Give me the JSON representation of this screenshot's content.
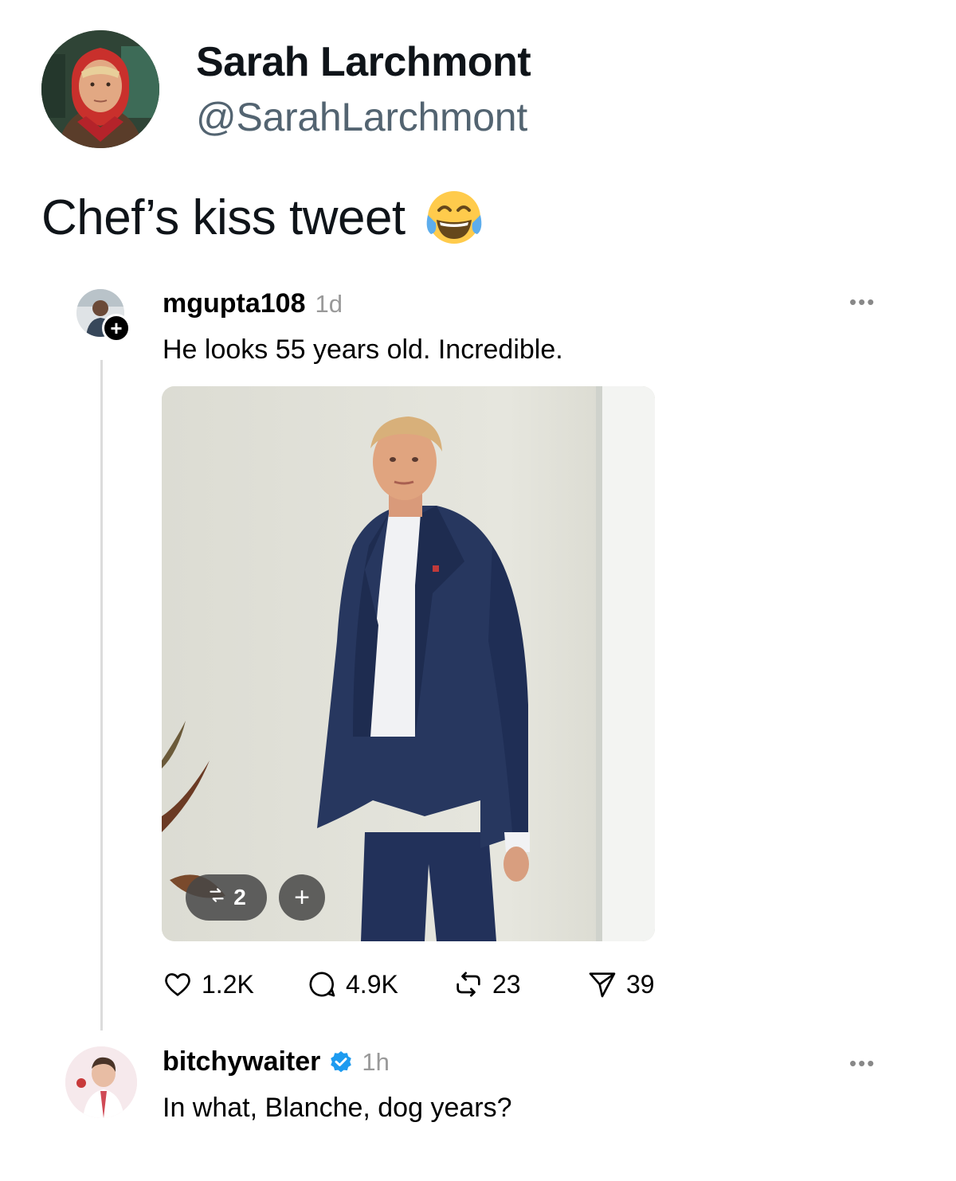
{
  "author": {
    "name": "Sarah Larchmont",
    "handle": "@SarahLarchmont"
  },
  "tweet": {
    "text": "Chef’s kiss tweet",
    "emoji": "face-with-tears-of-joy"
  },
  "quoted_post": {
    "username": "mgupta108",
    "time": "1d",
    "text": "He looks 55 years old. Incredible.",
    "image_reposts": "2",
    "stats": {
      "likes": "1.2K",
      "replies": "4.9K",
      "reposts": "23",
      "shares": "39"
    }
  },
  "reply_post": {
    "username": "bitchywaiter",
    "verified": true,
    "time": "1h",
    "text": "In what, Blanche, dog years?"
  },
  "colors": {
    "handle": "#536471",
    "verified": "#1d9bf0",
    "thread_line": "#dcdcdc",
    "suit": "#27375f"
  }
}
